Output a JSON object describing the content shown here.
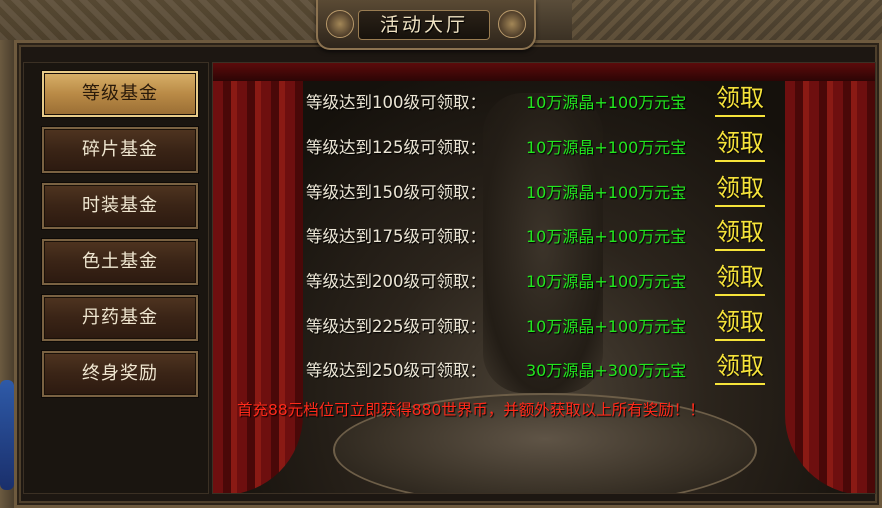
{
  "window": {
    "title": "活动大厅"
  },
  "sidebar": {
    "items": [
      {
        "label": "等级基金",
        "active": true
      },
      {
        "label": "碎片基金",
        "active": false
      },
      {
        "label": "时装基金",
        "active": false
      },
      {
        "label": "色土基金",
        "active": false
      },
      {
        "label": "丹药基金",
        "active": false
      },
      {
        "label": "终身奖励",
        "active": false
      }
    ]
  },
  "rewards": {
    "rows": [
      {
        "requirement": "等级达到100级可领取：",
        "reward": "10万源晶+100万元宝",
        "button": "领取"
      },
      {
        "requirement": "等级达到125级可领取：",
        "reward": "10万源晶+100万元宝",
        "button": "领取"
      },
      {
        "requirement": "等级达到150级可领取：",
        "reward": "10万源晶+100万元宝",
        "button": "领取"
      },
      {
        "requirement": "等级达到175级可领取：",
        "reward": "10万源晶+100万元宝",
        "button": "领取"
      },
      {
        "requirement": "等级达到200级可领取：",
        "reward": "10万源晶+100万元宝",
        "button": "领取"
      },
      {
        "requirement": "等级达到225级可领取：",
        "reward": "10万源晶+100万元宝",
        "button": "领取"
      },
      {
        "requirement": "等级达到250级可领取：",
        "reward": "30万源晶+300万元宝",
        "button": "领取"
      }
    ],
    "notice": "首充88元档位可立即获得880世界币，并额外获取以上所有奖励！！"
  },
  "colors": {
    "reward_text": "#22e61e",
    "claim_button": "#f6e33a",
    "notice_text": "#ff2a1a",
    "active_tab": "#d8b068"
  }
}
